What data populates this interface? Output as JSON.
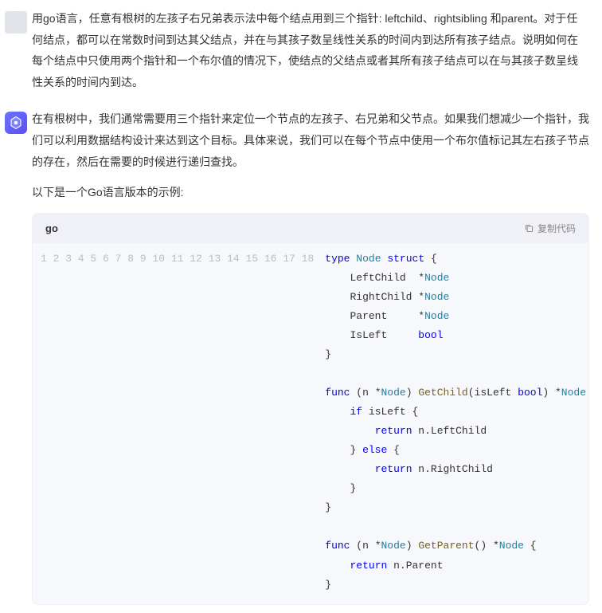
{
  "question": "用go语言，任意有根树的左孩子右兄弟表示法中每个结点用到三个指针: leftchild、rightsibling 和parent。对于任何结点，都可以在常数时间到达其父结点，并在与其孩子数呈线性关系的时间内到达所有孩子结点。说明如何在每个结点中只使用两个指针和一个布尔值的情况下，使结点的父结点或者其所有孩子结点可以在与其孩子数呈线性关系的时间内到达。",
  "answer": {
    "p1": "在有根树中，我们通常需要用三个指针来定位一个节点的左孩子、右兄弟和父节点。如果我们想减少一个指针，我们可以利用数据结构设计来达到这个目标。具体来说，我们可以在每个节点中使用一个布尔值标记其左右孩子节点的存在，然后在需要的时候进行递归查找。",
    "p2": "以下是一个Go语言版本的示例:"
  },
  "code": {
    "lang": "go",
    "copy_label": "复制代码",
    "line_count": 18,
    "tokens": {
      "l1": {
        "a": "type",
        "b": "Node",
        "c": "struct",
        "d": " {"
      },
      "l2": {
        "a": "    LeftChild  *",
        "b": "Node"
      },
      "l3": {
        "a": "    RightChild *",
        "b": "Node"
      },
      "l4": {
        "a": "    Parent     *",
        "b": "Node"
      },
      "l5": {
        "a": "    IsLeft     ",
        "b": "bool"
      },
      "l6": {
        "a": "}"
      },
      "l7": {
        "a": ""
      },
      "l8": {
        "a": "func",
        "b": " (n *",
        "c": "Node",
        "d": ") ",
        "e": "GetChild",
        "f": "(isLeft ",
        "g": "bool",
        "h": ") *",
        "i": "Node",
        "j": " {"
      },
      "l9": {
        "a": "    ",
        "b": "if",
        "c": " isLeft {"
      },
      "l10": {
        "a": "        ",
        "b": "return",
        "c": " n.LeftChild"
      },
      "l11": {
        "a": "    } ",
        "b": "else",
        "c": " {"
      },
      "l12": {
        "a": "        ",
        "b": "return",
        "c": " n.RightChild"
      },
      "l13": {
        "a": "    }"
      },
      "l14": {
        "a": "}"
      },
      "l15": {
        "a": ""
      },
      "l16": {
        "a": "func",
        "b": " (n *",
        "c": "Node",
        "d": ") ",
        "e": "GetParent",
        "f": "() *",
        "g": "Node",
        "h": " {"
      },
      "l17": {
        "a": "    ",
        "b": "return",
        "c": " n.Parent"
      },
      "l18": {
        "a": "}"
      }
    }
  }
}
